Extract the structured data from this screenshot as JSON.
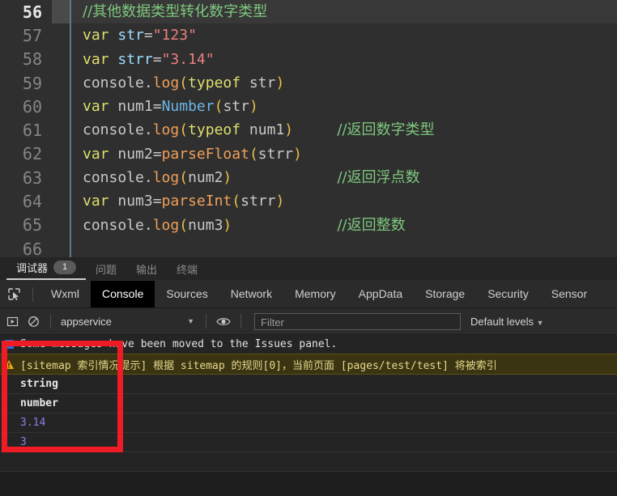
{
  "editor": {
    "lines": [
      {
        "num": "56",
        "active": true,
        "tokens": [
          {
            "t": "//其他数据类型转化数字类型",
            "c": "tk-comment"
          }
        ],
        "comment": ""
      },
      {
        "num": "57",
        "active": false,
        "tokens": [
          {
            "t": "var ",
            "c": "tk-key"
          },
          {
            "t": "str",
            "c": "tk-var"
          },
          {
            "t": "=",
            "c": "tk-punc"
          },
          {
            "t": "\"123\"",
            "c": "tk-str"
          }
        ],
        "comment": ""
      },
      {
        "num": "58",
        "active": false,
        "tokens": [
          {
            "t": "var ",
            "c": "tk-key"
          },
          {
            "t": "strr",
            "c": "tk-var"
          },
          {
            "t": "=",
            "c": "tk-punc"
          },
          {
            "t": "\"3.14\"",
            "c": "tk-str"
          }
        ],
        "comment": ""
      },
      {
        "num": "59",
        "active": false,
        "tokens": [
          {
            "t": "console",
            "c": "tk-plain"
          },
          {
            "t": ".",
            "c": "tk-punc"
          },
          {
            "t": "log",
            "c": "tk-fn"
          },
          {
            "t": "(",
            "c": "tk-paren"
          },
          {
            "t": "typeof",
            "c": "tk-key"
          },
          {
            "t": " str",
            "c": "tk-plain"
          },
          {
            "t": ")",
            "c": "tk-paren"
          }
        ],
        "comment": ""
      },
      {
        "num": "60",
        "active": false,
        "tokens": [
          {
            "t": "var ",
            "c": "tk-key"
          },
          {
            "t": "num1",
            "c": "tk-plain"
          },
          {
            "t": "=",
            "c": "tk-punc"
          },
          {
            "t": "Number",
            "c": "tk-blue"
          },
          {
            "t": "(",
            "c": "tk-paren"
          },
          {
            "t": "str",
            "c": "tk-plain"
          },
          {
            "t": ")",
            "c": "tk-paren"
          }
        ],
        "comment": ""
      },
      {
        "num": "61",
        "active": false,
        "tokens": [
          {
            "t": "console",
            "c": "tk-plain"
          },
          {
            "t": ".",
            "c": "tk-punc"
          },
          {
            "t": "log",
            "c": "tk-fn"
          },
          {
            "t": "(",
            "c": "tk-paren"
          },
          {
            "t": "typeof",
            "c": "tk-key"
          },
          {
            "t": " num1",
            "c": "tk-plain"
          },
          {
            "t": ")",
            "c": "tk-paren"
          }
        ],
        "comment": "//返回数字类型"
      },
      {
        "num": "62",
        "active": false,
        "tokens": [
          {
            "t": "var ",
            "c": "tk-key"
          },
          {
            "t": "num2",
            "c": "tk-plain"
          },
          {
            "t": "=",
            "c": "tk-punc"
          },
          {
            "t": "parseFloat",
            "c": "tk-fn"
          },
          {
            "t": "(",
            "c": "tk-paren"
          },
          {
            "t": "strr",
            "c": "tk-plain"
          },
          {
            "t": ")",
            "c": "tk-paren"
          }
        ],
        "comment": ""
      },
      {
        "num": "63",
        "active": false,
        "tokens": [
          {
            "t": "console",
            "c": "tk-plain"
          },
          {
            "t": ".",
            "c": "tk-punc"
          },
          {
            "t": "log",
            "c": "tk-fn"
          },
          {
            "t": "(",
            "c": "tk-paren"
          },
          {
            "t": "num2",
            "c": "tk-plain"
          },
          {
            "t": ")",
            "c": "tk-paren"
          }
        ],
        "comment": "//返回浮点数"
      },
      {
        "num": "64",
        "active": false,
        "tokens": [
          {
            "t": "var ",
            "c": "tk-key"
          },
          {
            "t": "num3",
            "c": "tk-plain"
          },
          {
            "t": "=",
            "c": "tk-punc"
          },
          {
            "t": "parseInt",
            "c": "tk-fn"
          },
          {
            "t": "(",
            "c": "tk-paren"
          },
          {
            "t": "strr",
            "c": "tk-plain"
          },
          {
            "t": ")",
            "c": "tk-paren"
          }
        ],
        "comment": ""
      },
      {
        "num": "65",
        "active": false,
        "tokens": [
          {
            "t": "console",
            "c": "tk-plain"
          },
          {
            "t": ".",
            "c": "tk-punc"
          },
          {
            "t": "log",
            "c": "tk-fn"
          },
          {
            "t": "(",
            "c": "tk-paren"
          },
          {
            "t": "num3",
            "c": "tk-plain"
          },
          {
            "t": ")",
            "c": "tk-paren"
          }
        ],
        "comment": "//返回整数"
      },
      {
        "num": "66",
        "active": false,
        "tokens": [],
        "comment": ""
      }
    ]
  },
  "panel_tabs": [
    {
      "label": "调试器",
      "badge": "1",
      "selected": true
    },
    {
      "label": "问题",
      "badge": "",
      "selected": false
    },
    {
      "label": "输出",
      "badge": "",
      "selected": false
    },
    {
      "label": "终端",
      "badge": "",
      "selected": false
    }
  ],
  "devtools_tabs": [
    {
      "label": "Wxml",
      "selected": false
    },
    {
      "label": "Console",
      "selected": true
    },
    {
      "label": "Sources",
      "selected": false
    },
    {
      "label": "Network",
      "selected": false
    },
    {
      "label": "Memory",
      "selected": false
    },
    {
      "label": "AppData",
      "selected": false
    },
    {
      "label": "Storage",
      "selected": false
    },
    {
      "label": "Security",
      "selected": false
    },
    {
      "label": "Sensor",
      "selected": false
    }
  ],
  "toolbar": {
    "inspect_icon": "inspect-cursor-icon",
    "execute_icon": "execute-arrow-icon",
    "clear_icon": "clear-console-icon",
    "eye_icon": "live-expression-eye-icon",
    "context_value": "appservice",
    "context_caret": "▼",
    "filter_placeholder": "Filter",
    "filter_value": "",
    "levels_label": "Default levels",
    "levels_caret": "▼"
  },
  "console": {
    "messages": [
      {
        "kind": "info-note",
        "icon": "info-icon",
        "text": "Some messages have been moved to the Issues panel."
      },
      {
        "kind": "warn",
        "icon": "warning-icon",
        "text": "[sitemap 索引情况提示] 根据 sitemap 的规则[0]，当前页面 [pages/test/test] 将被索引"
      },
      {
        "kind": "log",
        "icon": "",
        "value_class": "val-str",
        "text": "string"
      },
      {
        "kind": "log",
        "icon": "",
        "value_class": "val-str",
        "text": "number"
      },
      {
        "kind": "log",
        "icon": "",
        "value_class": "val-num",
        "text": "3.14"
      },
      {
        "kind": "log",
        "icon": "",
        "value_class": "val-num",
        "text": "3"
      },
      {
        "kind": "log",
        "icon": "",
        "value_class": "",
        "text": ""
      }
    ]
  },
  "annotation": {
    "highlight_color": "#ef1c26",
    "shape": "rectangle"
  }
}
